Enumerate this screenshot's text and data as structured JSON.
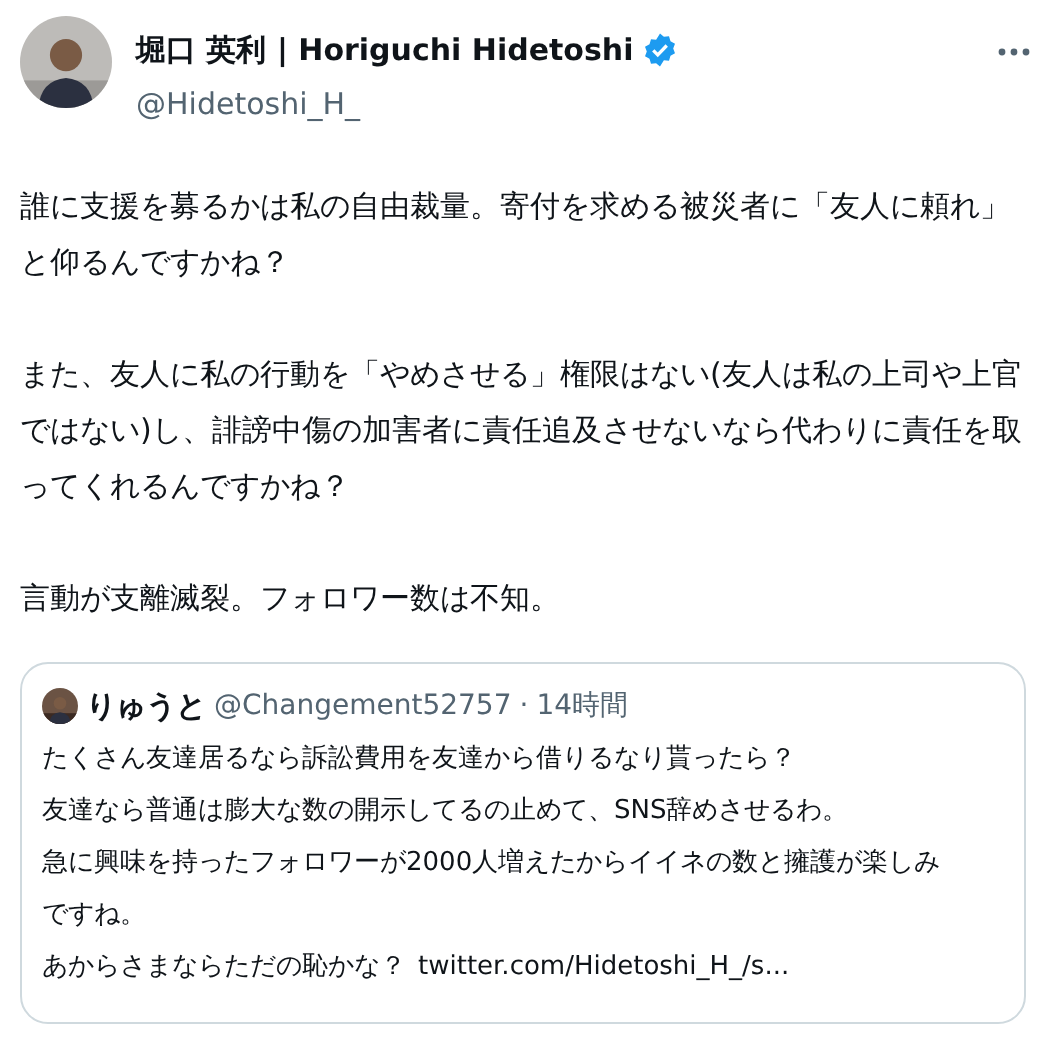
{
  "author": {
    "name": "堀口 英利 | Horiguchi Hidetoshi",
    "verified": true,
    "handle": "@Hidetoshi_H_"
  },
  "paragraphs": [
    "誰に支援を募るかは私の自由裁量。寄付を求める被災者に「友人に頼れ」と仰るんですかね？",
    "また、友人に私の行動を「やめさせる」権限はない(友人は私の上司や上官ではない)し、誹謗中傷の加害者に責任追及させないなら代わりに責任を取ってくれるんですかね？",
    "言動が支離滅裂。フォロワー数は不知。"
  ],
  "quote": {
    "name": "りゅうと",
    "handle": "@Changement52757",
    "separator": "·",
    "time": "14時間",
    "lines": [
      "たくさん友達居るなら訴訟費用を友達から借りるなり貰ったら？",
      "友達なら普通は膨大な数の開示してるの止めて、SNS辞めさせるわ。",
      "急に興味を持ったフォロワーが2000人増えたからイイネの数と擁護が楽しみですね。",
      "あからさまならただの恥かな？"
    ],
    "link": "twitter.com/Hidetoshi_H_/s..."
  }
}
